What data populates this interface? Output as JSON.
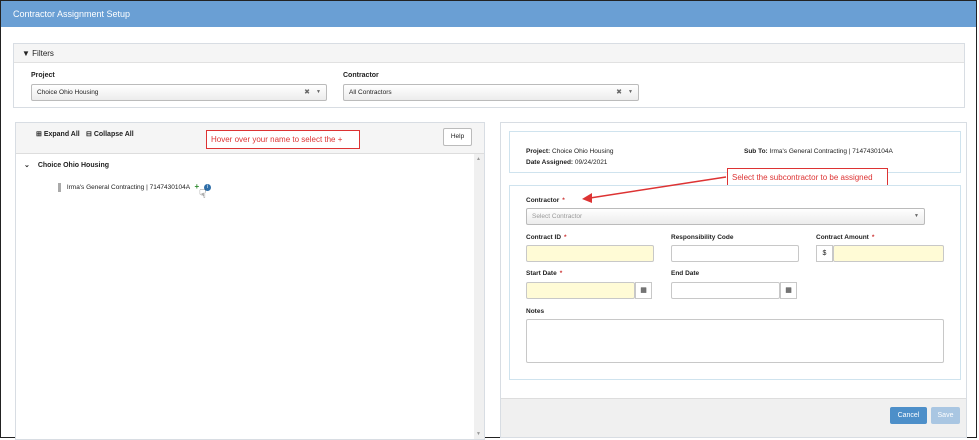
{
  "window": {
    "title": "Contractor Assignment Setup"
  },
  "filters": {
    "header": "Filters",
    "project_label": "Project",
    "project_value": "Choice Ohio Housing",
    "contractor_label": "Contractor",
    "contractor_value": "All Contractors"
  },
  "tree": {
    "expand_all": "Expand All",
    "collapse_all": "Collapse All",
    "help": "Help",
    "hover_callout": "Hover over your name to select the +",
    "root": "Choice Ohio Housing",
    "child": "Irma's General Contracting | 7147430104A"
  },
  "details": {
    "project_label": "Project:",
    "project_value": "Choice Ohio Housing",
    "date_label": "Date Assigned:",
    "date_value": "09/24/2021",
    "subto_label": "Sub To:",
    "subto_value": "Irma's General Contracting | 7147430104A"
  },
  "form": {
    "callout": "Select the subcontractor to be assigned",
    "contractor_label": "Contractor",
    "contractor_placeholder": "Select Contractor",
    "contract_id_label": "Contract ID",
    "resp_code_label": "Responsibility Code",
    "amount_label": "Contract Amount",
    "currency": "$",
    "start_label": "Start Date",
    "end_label": "End Date",
    "notes_label": "Notes",
    "required_mark": "*"
  },
  "buttons": {
    "cancel": "Cancel",
    "save": "Save"
  },
  "colors": {
    "titlebar": "#6a9fd4",
    "primary_button": "#4d8fc9",
    "callout_red": "#dd3333",
    "required_field": "#fffbd6"
  }
}
